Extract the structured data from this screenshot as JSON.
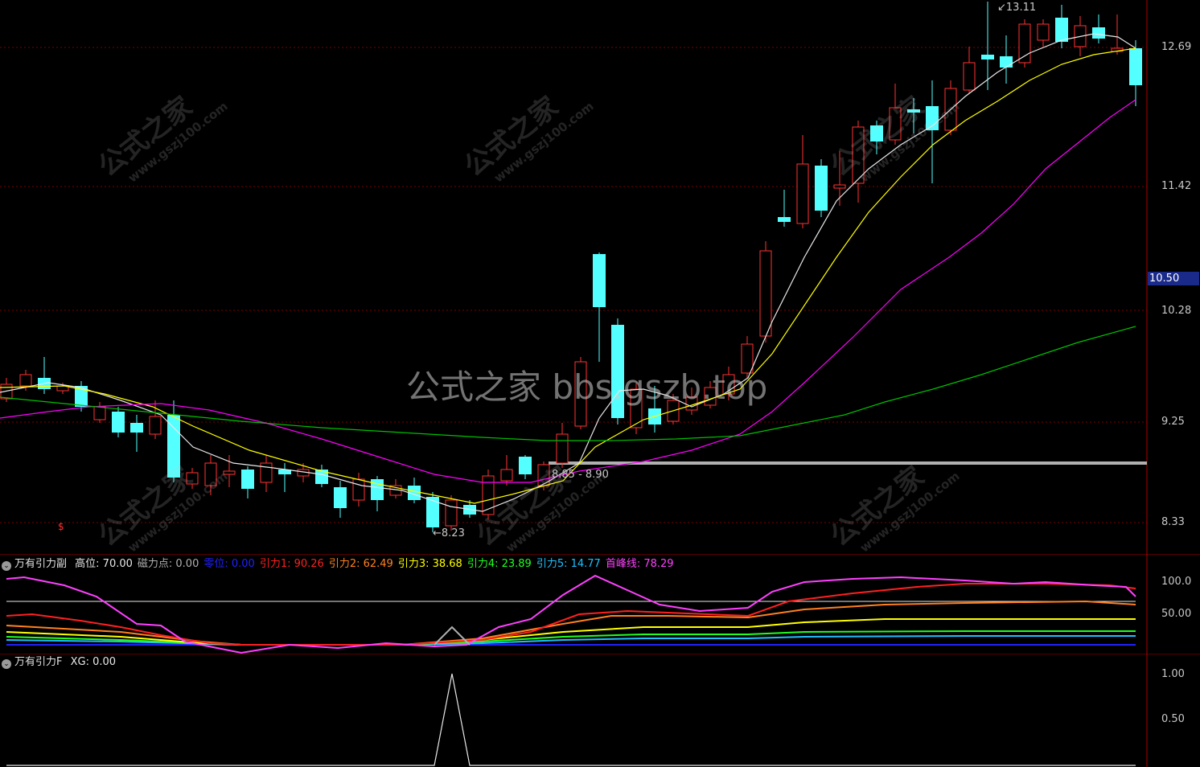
{
  "colors": {
    "up": "#ff3232",
    "down": "#54ffff",
    "ma5": "#e8e8e8",
    "ma10": "#ffff00",
    "ma20": "#ff00ff",
    "ma60": "#00c000",
    "grid": "#7a0000",
    "border": "#b00000"
  },
  "main": {
    "price_axis": [
      "12.69",
      "11.42",
      "10.28",
      "9.25",
      "8.33"
    ],
    "current_price_badge": "10.50",
    "annotations": {
      "high": "13.11",
      "low": "8.23",
      "range": "8.85 - 8.90",
      "signal_marker": "$"
    },
    "watermark_center": "公式之家 bbs.gszb.top",
    "watermark_text": "公式之家",
    "watermark_url": "www.gszj100.com"
  },
  "sub_indicator": {
    "name": "万有引力副",
    "items": [
      {
        "label": "高位: 70.00",
        "color": "#e8e8e8"
      },
      {
        "label": "磁力点: 0.00",
        "color": "#b0b0b0"
      },
      {
        "label": "零位: 0.00",
        "color": "#2020ff"
      },
      {
        "label": "引力1: 90.26",
        "color": "#ff2020"
      },
      {
        "label": "引力2: 62.49",
        "color": "#ff8020"
      },
      {
        "label": "引力3: 38.68",
        "color": "#ffff00"
      },
      {
        "label": "引力4: 23.89",
        "color": "#20ff20"
      },
      {
        "label": "引力5: 14.77",
        "color": "#20c0ff"
      },
      {
        "label": "首峰线: 78.29",
        "color": "#ff40ff"
      }
    ],
    "axis": [
      "100.0",
      "50.00"
    ]
  },
  "f_indicator": {
    "name": "万有引力F",
    "items": [
      {
        "label": "XG: 0.00",
        "color": "#e8e8e8"
      }
    ],
    "axis": [
      "1.00",
      "0.50"
    ]
  }
}
